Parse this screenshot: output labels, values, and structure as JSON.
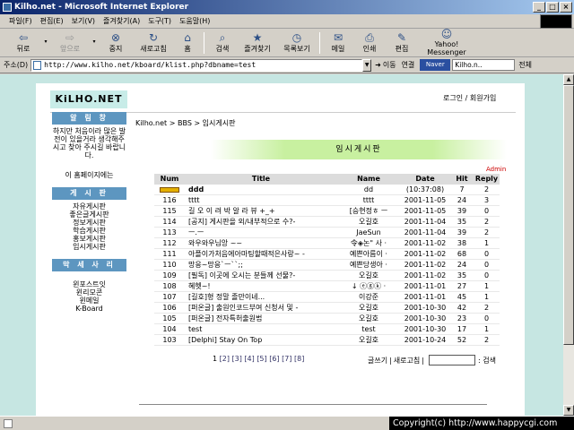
{
  "window": {
    "title": "Kilho.net - Microsoft Internet Explorer"
  },
  "menu": [
    "파일(F)",
    "편집(E)",
    "보기(V)",
    "즐겨찾기(A)",
    "도구(T)",
    "도움말(H)"
  ],
  "toolbar": {
    "back": "뒤로",
    "forward": "앞으로",
    "stop": "중지",
    "refresh": "새로고침",
    "home": "홈",
    "search": "검색",
    "favorites": "즐겨찾기",
    "history": "목록보기",
    "mail": "메일",
    "print": "인쇄",
    "edit": "편집",
    "messenger": "Yahoo! Messenger"
  },
  "address": {
    "label": "주소(D)",
    "url": "http://www.kilho.net/kboard/klist.php?dbname=test",
    "go": "이동",
    "links": "연결",
    "search_placeholder": "Kilho.n..",
    "display": "전체"
  },
  "site": {
    "logo": "KiLHO.NET",
    "login": "로그인 / 회원가입"
  },
  "sidebar": {
    "notice": {
      "header": "알 림 창",
      "text": "하지만 처음이라 많은 발전이 있을거라 생각해주시고 찾아 주시길 바랍니다.",
      "footer": "이 홈페이지에는"
    },
    "board": {
      "header": "게 시 판",
      "items": [
        "자유게시판",
        "좋은글게시판",
        "정보게시판",
        "학습게시판",
        "홍보게시판",
        "임시게시판"
      ]
    },
    "links": {
      "header": "막 세 사 리",
      "items": [
        "윈포스트잇",
        "윈리모콘",
        "윈메일",
        "K-Board"
      ]
    }
  },
  "breadcrumb": "Kilho.net > BBS > 임시게시판",
  "board_title": "임시게시판",
  "admin_label": "Admin",
  "table": {
    "headers": [
      "Num",
      "Title",
      "Name",
      "Date",
      "Hit",
      "Reply"
    ],
    "notice": {
      "title": "ddd",
      "name": "dd",
      "date": "(10:37:08)",
      "hit": "7",
      "reply": "2"
    },
    "rows": [
      {
        "num": "116",
        "title": "tttt",
        "name": "tttt",
        "date": "2001-11-05",
        "hit": "24",
        "reply": "3"
      },
      {
        "num": "115",
        "title": "길 오 이 려 박 알 라 뷰 +_+",
        "name": "[승현정ㅎ ㅡ",
        "date": "2001-11-05",
        "hit": "39",
        "reply": "0"
      },
      {
        "num": "114",
        "title": "[공지] 게시판을 외/내부적으로 수?-",
        "name": "오길호",
        "date": "2001-11-04",
        "hit": "35",
        "reply": "2"
      },
      {
        "num": "113",
        "title": "ㅡ.ㅡ",
        "name": "JaeSun",
        "date": "2001-11-04",
        "hit": "39",
        "reply": "2"
      },
      {
        "num": "112",
        "title": "와우와우님앙 ~~",
        "name": "令◈논\" 사 ·",
        "date": "2001-11-02",
        "hit": "38",
        "reply": "1"
      },
      {
        "num": "111",
        "title": "아플이가처음에아마팅할때적은사랑~ -",
        "name": "예쁜아름이 ·",
        "date": "2001-11-02",
        "hit": "68",
        "reply": "0"
      },
      {
        "num": "110",
        "title": "망응~망응`ㅡ``;;",
        "name": "예쁜당생아 ·",
        "date": "2001-11-02",
        "hit": "24",
        "reply": "0"
      },
      {
        "num": "109",
        "title": "[필독] 이곳에 오시는 분들께 선물?-",
        "name": "오길호",
        "date": "2001-11-02",
        "hit": "35",
        "reply": "0"
      },
      {
        "num": "108",
        "title": "혜헷~!",
        "name": "↓ ⓔⓖⓚ ·",
        "date": "2001-11-01",
        "hit": "27",
        "reply": "1"
      },
      {
        "num": "107",
        "title": "[길호]형 정말 졸만이네...",
        "name": "이강준",
        "date": "2001-11-01",
        "hit": "45",
        "reply": "1"
      },
      {
        "num": "106",
        "title": "[퍼온글] 출원인코드부여 신청서 및 -",
        "name": "오길호",
        "date": "2001-10-30",
        "hit": "42",
        "reply": "2"
      },
      {
        "num": "105",
        "title": "[퍼온글] 전자특허출원법",
        "name": "오길호",
        "date": "2001-10-30",
        "hit": "23",
        "reply": "0"
      },
      {
        "num": "104",
        "title": "test",
        "name": "test",
        "date": "2001-10-30",
        "hit": "17",
        "reply": "1"
      },
      {
        "num": "103",
        "title": "[Delphi] Stay On Top",
        "name": "오길호",
        "date": "2001-10-24",
        "hit": "52",
        "reply": "2"
      }
    ]
  },
  "pager": {
    "current": "1",
    "pages": [
      "[2]",
      "[3]",
      "[4]",
      "[5]",
      "[6]",
      "[7]",
      "[8]"
    ]
  },
  "tools": {
    "write": "글쓰기",
    "refresh": "새로고침",
    "search": "검색"
  },
  "copyright": "Copyright(c) http://www.happycgi.com"
}
